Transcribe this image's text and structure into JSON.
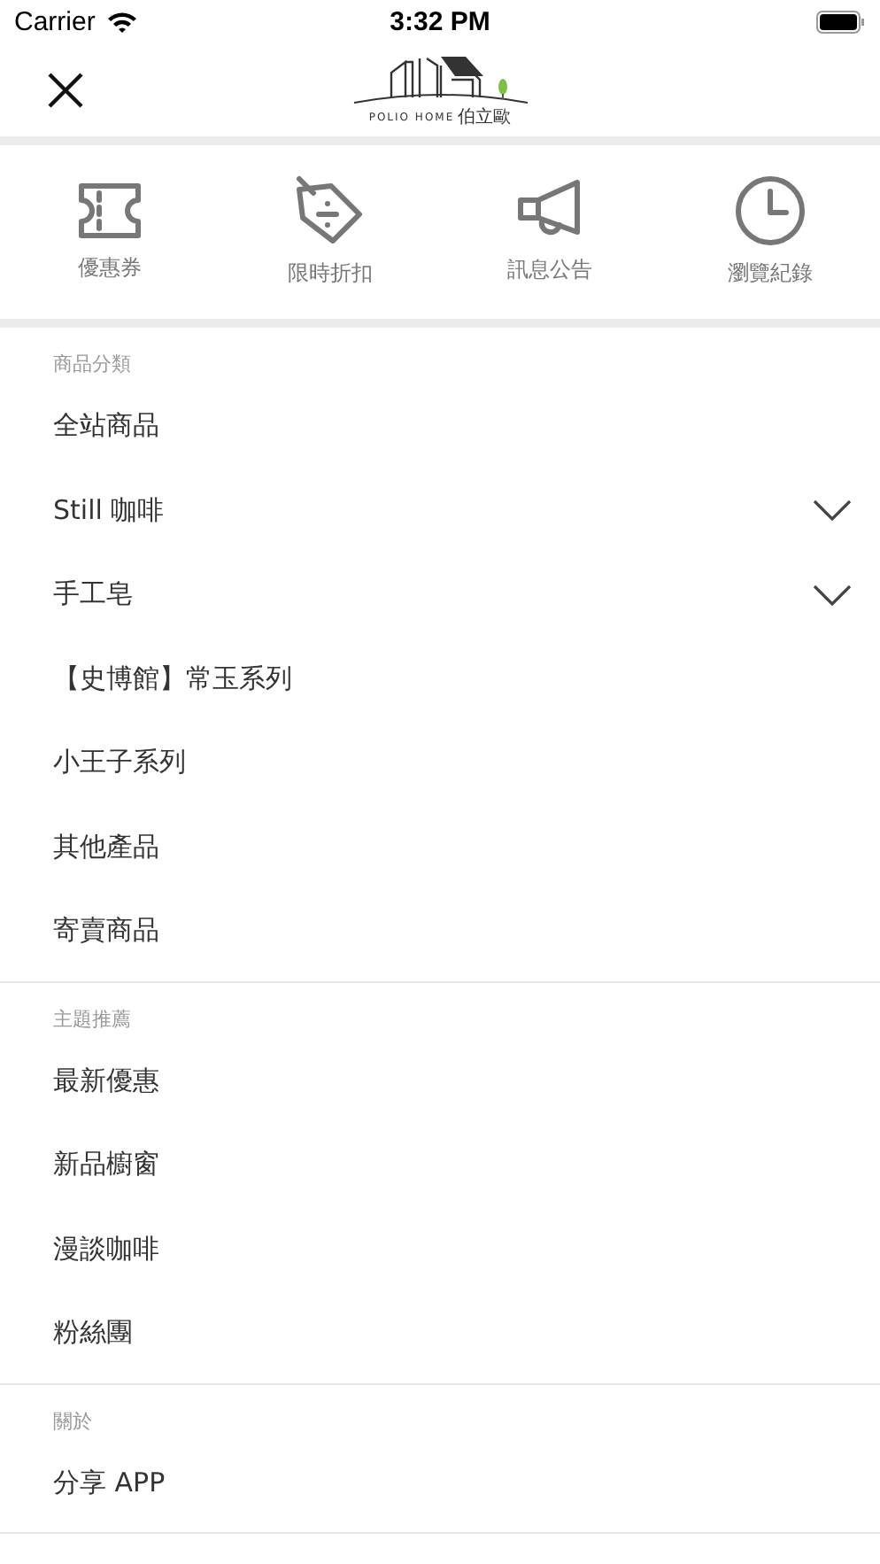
{
  "status_bar": {
    "carrier": "Carrier",
    "time": "3:32 PM"
  },
  "header": {
    "logo_text": "POLIO HOME",
    "logo_text_cjk": "伯立歐"
  },
  "shortcuts": [
    {
      "kind": "ticket",
      "label": "優惠券"
    },
    {
      "kind": "tag",
      "label": "限時折扣"
    },
    {
      "kind": "megaphone",
      "label": "訊息公告"
    },
    {
      "kind": "clock",
      "label": "瀏覽紀錄"
    }
  ],
  "sections": [
    {
      "title": "商品分類",
      "items": [
        {
          "label": "全站商品",
          "kind": "link"
        },
        {
          "label": "Still 咖啡",
          "kind": "expandable"
        },
        {
          "label": "手工皂",
          "kind": "expandable"
        },
        {
          "label": "【史博館】常玉系列",
          "kind": "link"
        },
        {
          "label": "小王子系列",
          "kind": "link"
        },
        {
          "label": "其他產品",
          "kind": "link"
        },
        {
          "label": "寄賣商品",
          "kind": "link"
        }
      ]
    },
    {
      "title": "主題推薦",
      "items": [
        {
          "label": "最新優惠",
          "kind": "link"
        },
        {
          "label": "新品櫥窗",
          "kind": "link"
        },
        {
          "label": "漫談咖啡",
          "kind": "link"
        },
        {
          "label": "粉絲團",
          "kind": "link"
        }
      ]
    },
    {
      "title": "關於",
      "items": [
        {
          "label": "分享 APP",
          "kind": "link"
        }
      ]
    }
  ]
}
